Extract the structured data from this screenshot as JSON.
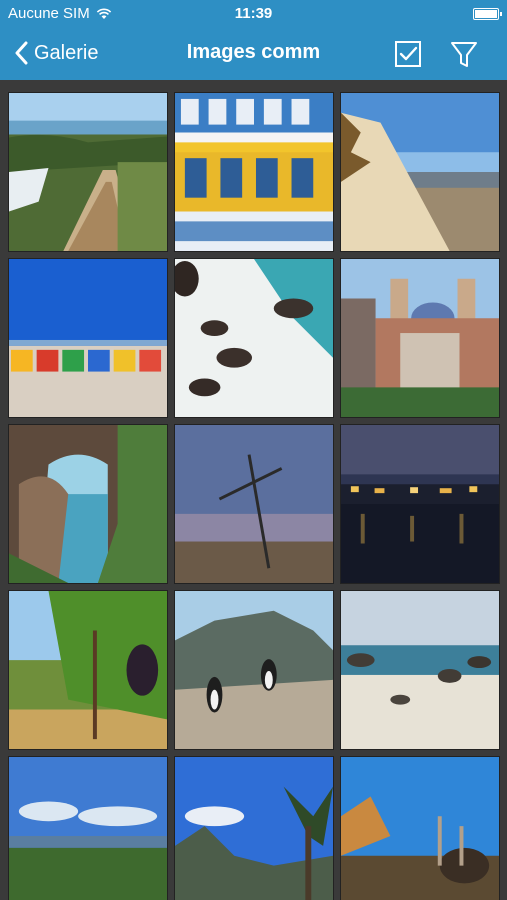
{
  "status_bar": {
    "carrier": "Aucune SIM",
    "time": "11:39"
  },
  "nav": {
    "back_label": "Galerie",
    "title": "Images comm",
    "select_icon": "checkbox-icon",
    "filter_icon": "filter-icon"
  },
  "colors": {
    "accent": "#2e8fc4",
    "grid_background": "#3a3a3a"
  },
  "gallery": {
    "thumbnails": [
      {
        "subject": "coastal-boardwalk"
      },
      {
        "subject": "colorful-victorian-building"
      },
      {
        "subject": "sand-dune-grass"
      },
      {
        "subject": "beach-huts"
      },
      {
        "subject": "rocks-in-surf"
      },
      {
        "subject": "city-hall-building"
      },
      {
        "subject": "rock-arch-sea"
      },
      {
        "subject": "wooden-cross-dusk"
      },
      {
        "subject": "waterfront-night"
      },
      {
        "subject": "vineyard-grapes"
      },
      {
        "subject": "penguins-mountain"
      },
      {
        "subject": "beach-boulders"
      },
      {
        "subject": "green-bush-coast"
      },
      {
        "subject": "palm-tree-mountain"
      },
      {
        "subject": "ostriches-rock"
      }
    ]
  }
}
